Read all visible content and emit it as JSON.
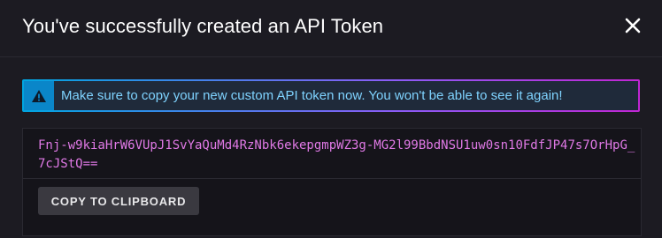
{
  "dialog": {
    "title": "You've successfully created an API Token",
    "close_icon": "close-icon"
  },
  "alert": {
    "icon": "warning-triangle-icon",
    "message": "Make sure to copy your new custom API token now. You won't be able to see it again!"
  },
  "token": {
    "value": "Fnj-w9kiaHrW6VUpJ1SvYaQuMd4RzNbk6ekepgmpWZ3g-MG2l99BbdNSU1uw0sn10FdfJP47s7OrHpG_7cJStQ=="
  },
  "actions": {
    "copy_label": "COPY TO CLIPBOARD"
  },
  "colors": {
    "background": "#1c1b22",
    "token_text": "#e079e6",
    "alert_text": "#7fd3ff",
    "alert_icon_bg": "#0a86c9"
  }
}
